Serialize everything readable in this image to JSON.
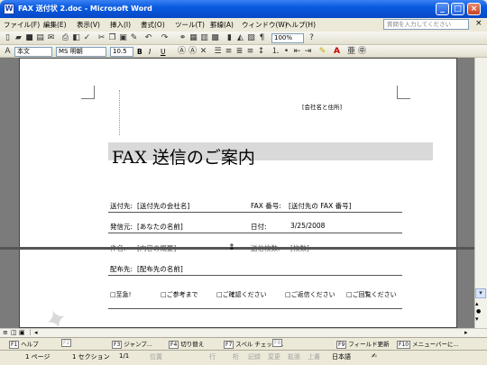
{
  "window": {
    "title": "FAX 送付状 2.doc - Microsoft Word",
    "icon": "W",
    "controls": [
      "_",
      "□",
      "×"
    ]
  },
  "menu": {
    "items": [
      "ファイル(F)",
      "編集(E)",
      "表示(V)",
      "挿入(I)",
      "書式(O)",
      "ツール(T)",
      "罫線(A)",
      "ウィンドウ(W)",
      "ヘルプ(H)"
    ],
    "help_placeholder": "質問を入力してください",
    "close_glyph": "×"
  },
  "toolbar": {
    "zoom": "100%",
    "style": "本文",
    "font": "MS 明朝",
    "size": "10.5",
    "bold": "B",
    "italic": "I",
    "underline": "U"
  },
  "document": {
    "company_address": "[会社名と住所]",
    "title": "FAX 送信のご案内",
    "fields": {
      "to_label": "送付先:",
      "to_value": "[送付先の会社名]",
      "fax_label": "FAX 番号:",
      "fax_value": "[送付先の FAX 番号]",
      "from_label": "発信元:",
      "from_value": "[あなたの名前]",
      "date_label": "日付:",
      "date_value": "3/25/2008",
      "subject_label": "件名:",
      "subject_value": "[内容の概要]",
      "pages_label": "送信枚数:",
      "pages_value": "[枚数]",
      "cc_label": "配布先:",
      "cc_value": "[配布先の名前]"
    },
    "checkboxes": [
      "□至急!",
      "□ご参考まで",
      "□ご確認ください",
      "□ご返信ください",
      "□ご回覧ください"
    ]
  },
  "function_keys": [
    {
      "key": "F1",
      "label": "ヘルプ"
    },
    {
      "key": "F2",
      "label": ""
    },
    {
      "key": "F3",
      "label": "ジャンプ..."
    },
    {
      "key": "F4",
      "label": "切り替え"
    },
    {
      "key": "F7",
      "label": "スペル チェック..."
    },
    {
      "key": "F8",
      "label": ""
    },
    {
      "key": "F9",
      "label": "フィールド更新"
    },
    {
      "key": "F10",
      "label": "メニューバーに..."
    }
  ],
  "status": {
    "page": "1 ページ",
    "section": "1 セクション",
    "page_of": "1/1",
    "position": "位置",
    "line": "行",
    "column": "桁",
    "rec": "記録",
    "trk": "変更",
    "ext": "拡張",
    "ovr": "上書",
    "language": "日本語"
  }
}
